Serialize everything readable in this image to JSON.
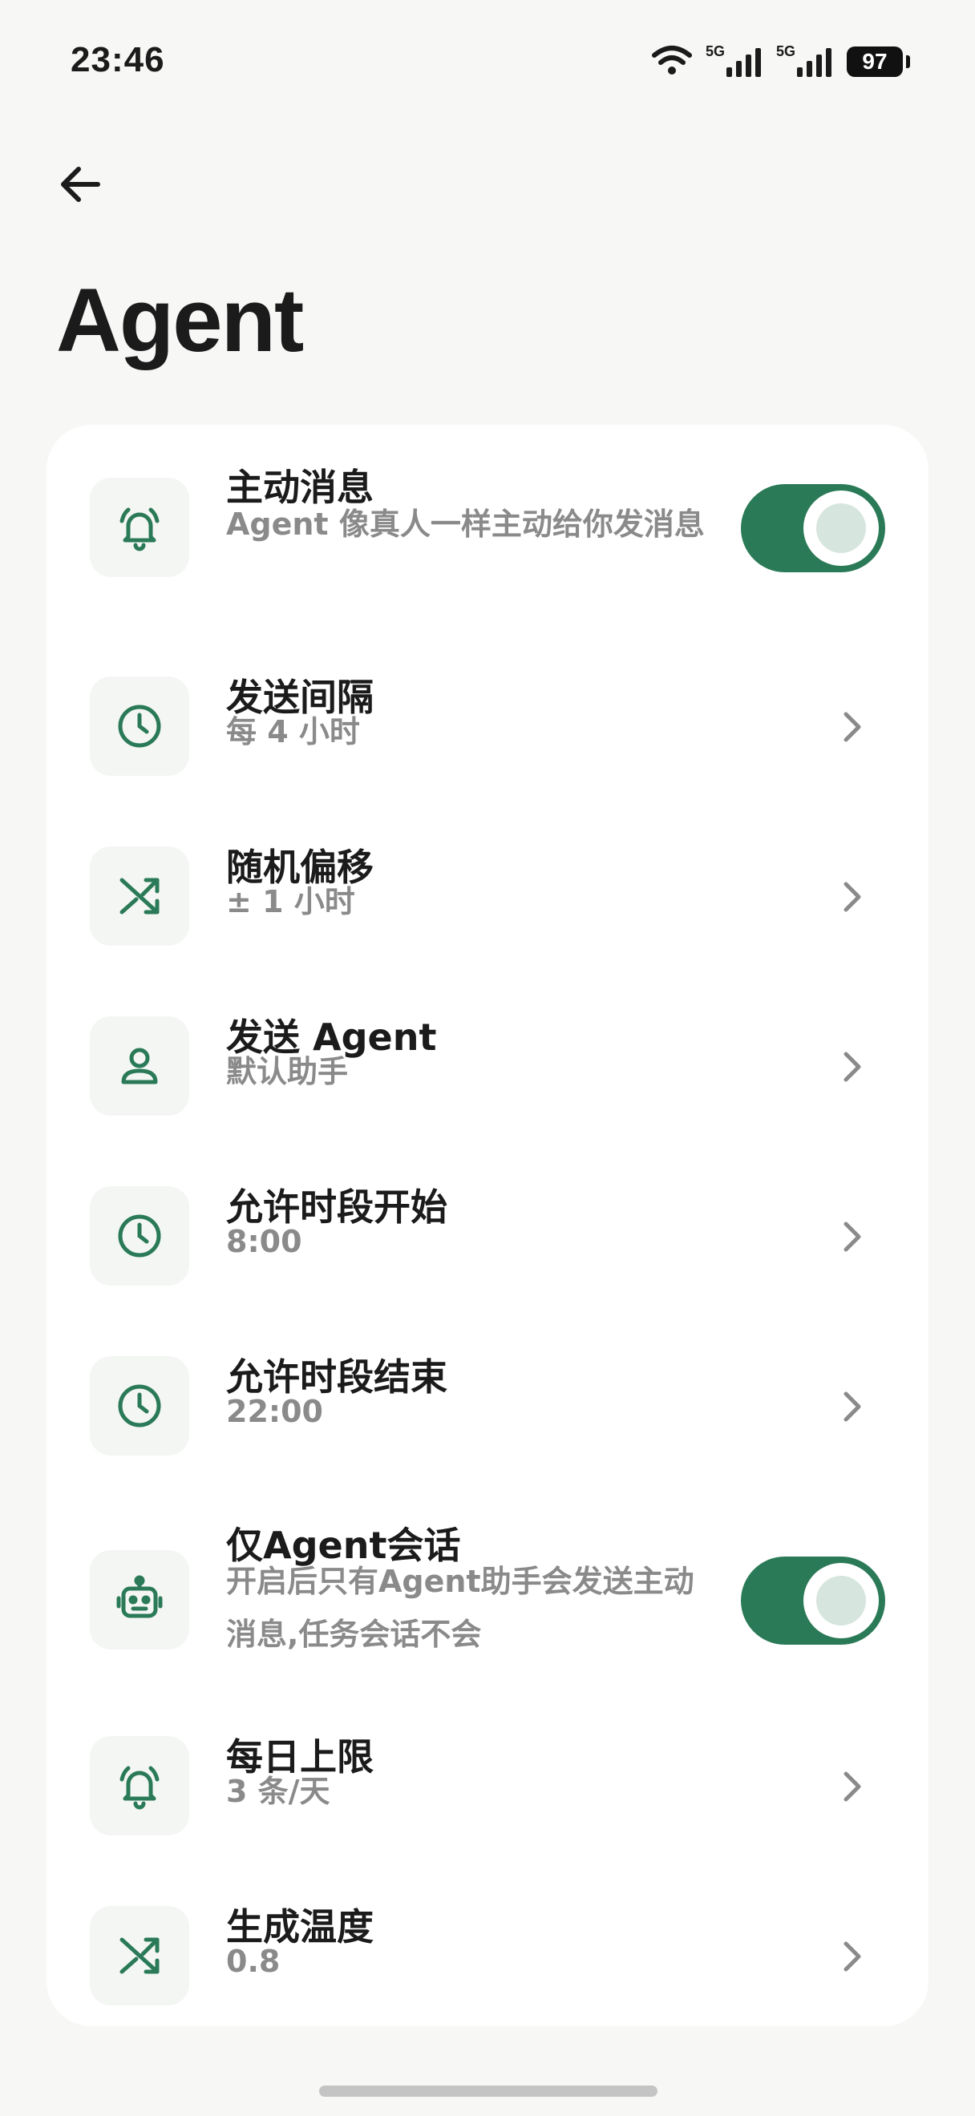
{
  "status_bar": {
    "time": "23:46",
    "signal_1_label": "5G",
    "signal_2_label": "5G",
    "battery": "97"
  },
  "header": {
    "title": "Agent"
  },
  "settings": [
    {
      "id": "proactive-message",
      "title": "主动消息",
      "subtitle": "Agent 像真人一样主动给你发消息",
      "control": "toggle",
      "on": true,
      "icon": "bell-ring-icon"
    },
    {
      "id": "send-interval",
      "title": "发送间隔",
      "subtitle": "每 4 小时",
      "control": "chevron",
      "icon": "clock-icon"
    },
    {
      "id": "random-offset",
      "title": "随机偏移",
      "subtitle": "± 1 小时",
      "control": "chevron",
      "icon": "shuffle-icon"
    },
    {
      "id": "send-agent",
      "title": "发送 Agent",
      "subtitle": "默认助手",
      "control": "chevron",
      "icon": "person-icon"
    },
    {
      "id": "allowed-start",
      "title": "允许时段开始",
      "subtitle": "8:00",
      "control": "chevron",
      "icon": "clock-icon"
    },
    {
      "id": "allowed-end",
      "title": "允许时段结束",
      "subtitle": "22:00",
      "control": "chevron",
      "icon": "clock-icon"
    },
    {
      "id": "agent-only",
      "title": "仅Agent会话",
      "subtitle": "开启后只有Agent助手会发送主动消息,任务会话不会",
      "control": "toggle",
      "on": true,
      "icon": "robot-icon"
    },
    {
      "id": "daily-limit",
      "title": "每日上限",
      "subtitle": "3 条/天",
      "control": "chevron",
      "icon": "bell-ring-icon"
    },
    {
      "id": "temperature",
      "title": "生成温度",
      "subtitle": "0.8",
      "control": "chevron",
      "icon": "shuffle-icon"
    }
  ],
  "colors": {
    "accent": "#2a7a57",
    "background": "#f7f7f5",
    "card": "#ffffff",
    "subtitle": "#8a8a8a"
  }
}
